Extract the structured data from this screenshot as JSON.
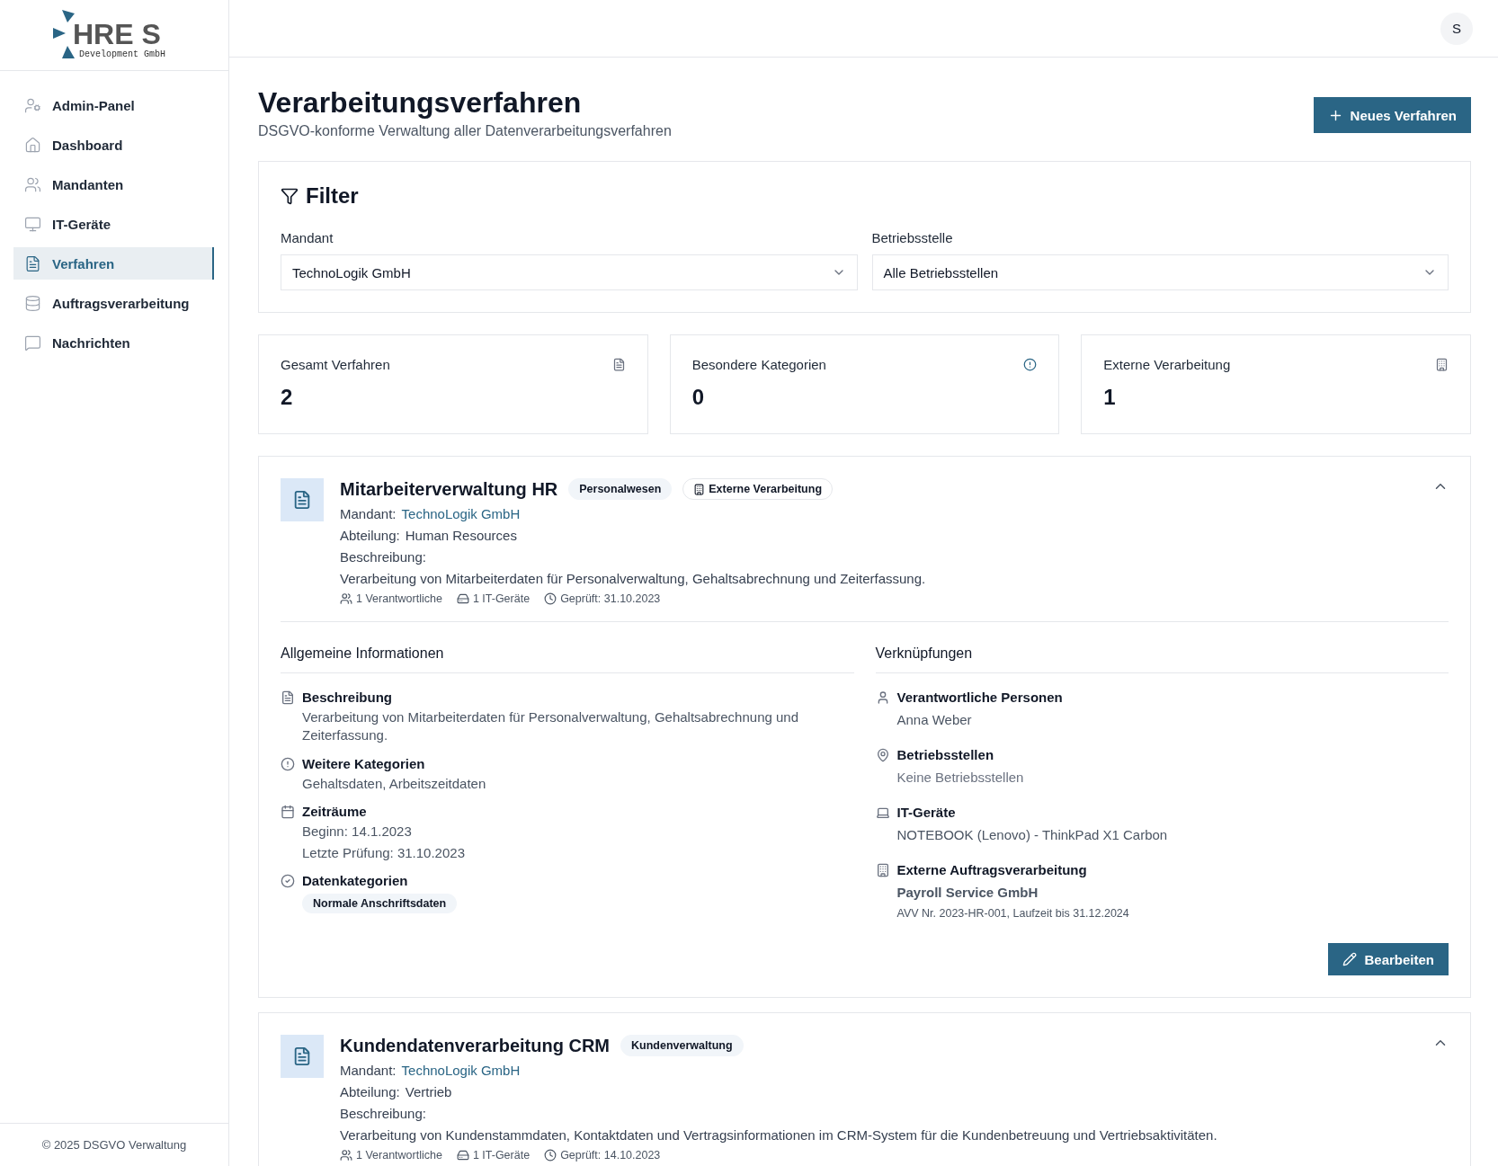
{
  "logo": {
    "mark": "HRE S",
    "subtitle": "Development GmbH"
  },
  "sidebar": {
    "items": [
      {
        "label": "Admin-Panel",
        "selected": false
      },
      {
        "label": "Dashboard",
        "selected": false
      },
      {
        "label": "Mandanten",
        "selected": false
      },
      {
        "label": "IT-Geräte",
        "selected": false
      },
      {
        "label": "Verfahren",
        "selected": true
      },
      {
        "label": "Auftragsverarbeitung",
        "selected": false
      },
      {
        "label": "Nachrichten",
        "selected": false
      }
    ],
    "footer": "© 2025 DSGVO Verwaltung"
  },
  "header": {
    "avatar": "S"
  },
  "page": {
    "title": "Verarbeitungsverfahren",
    "subtitle": "DSGVO-konforme Verwaltung aller Datenverarbeitungsverfahren",
    "new_button": "Neues Verfahren"
  },
  "filter": {
    "title": "Filter",
    "fields": [
      {
        "label": "Mandant",
        "value": "TechnoLogik GmbH"
      },
      {
        "label": "Betriebsstelle",
        "value": "Alle Betriebsstellen"
      }
    ]
  },
  "stats": [
    {
      "label": "Gesamt Verfahren",
      "value": "2"
    },
    {
      "label": "Besondere Kategorien",
      "value": "0"
    },
    {
      "label": "Externe Verarbeitung",
      "value": "1"
    }
  ],
  "procedures": [
    {
      "title": "Mitarbeiterverwaltung HR",
      "expanded": true,
      "tags": [
        {
          "label": "Personalwesen",
          "kind": "category"
        },
        {
          "label": "Externe Verarbeitung",
          "kind": "external"
        }
      ],
      "fields": [
        {
          "label": "Mandant:",
          "value": "TechnoLogik GmbH",
          "kind": "link"
        },
        {
          "label": "Abteilung:",
          "value": "Human Resources",
          "kind": "text"
        }
      ],
      "description_label": "Beschreibung:",
      "description": "Verarbeitung von Mitarbeiterdaten für Personalverwaltung, Gehaltsabrechnung und Zeiterfassung.",
      "meta": {
        "responsible": "1 Verantwortliche",
        "devices": "1 IT-Geräte",
        "checked": "Geprüft: 31.10.2023"
      },
      "details": {
        "general": {
          "title": "Allgemeine Informationen",
          "items": [
            {
              "label": "Beschreibung",
              "lines": [
                "Verarbeitung von Mitarbeiterdaten für Personalverwaltung, Gehaltsabrechnung und Zeiterfassung."
              ]
            },
            {
              "label": "Weitere Kategorien",
              "lines": [
                "Gehaltsdaten, Arbeitszeitdaten"
              ]
            },
            {
              "label": "Zeiträume",
              "lines": [
                "Beginn: 14.1.2023",
                "Letzte Prüfung: 31.10.2023"
              ]
            },
            {
              "label": "Datenkategorien",
              "tags": [
                "Normale Anschriftsdaten"
              ]
            }
          ]
        },
        "links": {
          "title": "Verknüpfungen",
          "items": [
            {
              "label": "Verantwortliche Personen",
              "lines": [
                {
                  "text": "Anna Weber",
                  "kind": "value"
                }
              ]
            },
            {
              "label": "Betriebsstellen",
              "lines": [
                {
                  "text": "Keine Betriebsstellen",
                  "kind": "empty"
                }
              ]
            },
            {
              "label": "IT-Geräte",
              "lines": [
                {
                  "text": "NOTEBOOK (Lenovo) - ThinkPad X1 Carbon",
                  "kind": "value"
                }
              ]
            },
            {
              "label": "Externe Auftragsverarbeitung",
              "lines": [
                {
                  "text": "Payroll Service GmbH",
                  "kind": "strong"
                },
                {
                  "text": "AVV Nr. 2023-HR-001, Laufzeit bis 31.12.2024",
                  "kind": "note"
                }
              ]
            }
          ]
        },
        "edit_button": "Bearbeiten"
      }
    },
    {
      "title": "Kundendatenverarbeitung CRM",
      "expanded": true,
      "tags": [
        {
          "label": "Kundenverwaltung",
          "kind": "category"
        }
      ],
      "fields": [
        {
          "label": "Mandant:",
          "value": "TechnoLogik GmbH",
          "kind": "link"
        },
        {
          "label": "Abteilung:",
          "value": "Vertrieb",
          "kind": "text"
        }
      ],
      "description_label": "Beschreibung:",
      "description": "Verarbeitung von Kundenstammdaten, Kontaktdaten und Vertragsinformationen im CRM-System für die Kundenbetreuung und Vertriebsaktivitäten.",
      "meta": {
        "responsible": "1 Verantwortliche",
        "devices": "1 IT-Geräte",
        "checked": "Geprüft: 14.10.2023"
      }
    }
  ]
}
